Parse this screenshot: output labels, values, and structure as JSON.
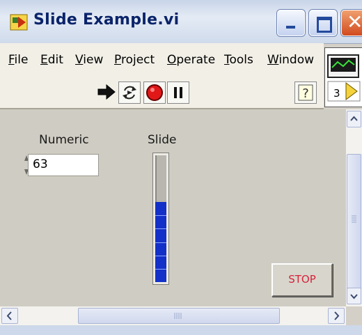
{
  "window": {
    "title": "Slide Example.vi",
    "controls": {
      "minimize": "minimize-icon",
      "maximize": "maximize-icon",
      "close": "close-icon"
    }
  },
  "menu": {
    "items": [
      {
        "label": "File",
        "underline": "F",
        "rest": "ile"
      },
      {
        "label": "Edit",
        "underline": "E",
        "rest": "dit"
      },
      {
        "label": "View",
        "underline": "V",
        "rest": "iew"
      },
      {
        "label": "Project",
        "underline": "P",
        "rest": "roject"
      },
      {
        "label": "Operate",
        "underline": "O",
        "rest": "perate"
      },
      {
        "label": "Tools",
        "underline": "T",
        "rest": "ools"
      },
      {
        "label": "Window",
        "underline": "W",
        "rest": "indow"
      }
    ]
  },
  "toolbar": {
    "run": "run-arrow-icon",
    "run_continuously": "run-continuously-icon",
    "abort": "abort-execution-icon",
    "pause": "pause-icon",
    "help": "help-icon"
  },
  "vi_icon": {
    "number": "3"
  },
  "panel": {
    "numeric": {
      "label": "Numeric",
      "value": "63"
    },
    "slide": {
      "label": "Slide",
      "level_fraction": 0.63
    },
    "stop": {
      "label": "STOP"
    }
  },
  "colors": {
    "slide_fill": "#1330c8",
    "stop_text": "#d8223a",
    "panel_bg": "#cfcdc3",
    "title_text": "#0a246a"
  }
}
